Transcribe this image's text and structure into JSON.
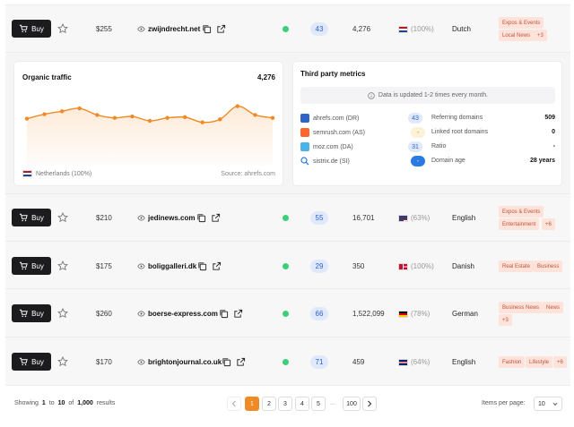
{
  "rows": [
    {
      "buy": "Buy",
      "price": "$255",
      "domain": "zwijndrecht.net",
      "dr": "43",
      "traffic": "4,276",
      "country_pct": "(100%)",
      "flag": "nl",
      "language": "Dutch",
      "tags": [
        "Expos & Events",
        "Local News",
        "+3"
      ]
    },
    {
      "buy": "Buy",
      "price": "$210",
      "domain": "jedinews.com",
      "dr": "55",
      "traffic": "16,701",
      "country_pct": "(63%)",
      "flag": "us",
      "language": "English",
      "tags": [
        "Expos & Events",
        "Entertainment",
        "+6"
      ]
    },
    {
      "buy": "Buy",
      "price": "$175",
      "domain": "boliggalleri.dk",
      "dr": "29",
      "traffic": "350",
      "country_pct": "(100%)",
      "flag": "dk",
      "language": "Danish",
      "tags": [
        "Real Estate",
        "Business"
      ]
    },
    {
      "buy": "Buy",
      "price": "$260",
      "domain": "boerse-express.com",
      "dr": "66",
      "traffic": "1,522,099",
      "country_pct": "(78%)",
      "flag": "de",
      "language": "German",
      "tags": [
        "Business News",
        "News",
        "+3"
      ]
    },
    {
      "buy": "Buy",
      "price": "$170",
      "domain": "brightonjournal.co.uk",
      "dr": "71",
      "traffic": "459",
      "country_pct": "(64%)",
      "flag": "gb",
      "language": "English",
      "tags": [
        "Fashion",
        "Lifestyle",
        "+6"
      ]
    }
  ],
  "organic": {
    "title": "Organic traffic",
    "value": "4,276",
    "country": "Netherlands (100%)",
    "source": "Source: ahrefs.com"
  },
  "chart_data": {
    "type": "area",
    "values": [
      3.2,
      3.5,
      3.7,
      3.9,
      3.45,
      3.25,
      3.35,
      3.05,
      3.25,
      3.3,
      2.95,
      3.15,
      4.05,
      3.45,
      3.25
    ],
    "ylim": [
      0,
      5
    ],
    "color": "#f08a24",
    "grid": false
  },
  "third_party": {
    "title": "Third party metrics",
    "info": "Data is updated 1-2 times every month.",
    "metrics": [
      {
        "name": "ahrefs.com (DR)",
        "value": "43",
        "color": "#2e64c8",
        "badge_bg": "#dfe9fb",
        "badge_fg": "#2e64c8",
        "icon": "ahrefs-logo"
      },
      {
        "name": "semrush.com (AS)",
        "value": "-",
        "color": "#ff642d",
        "badge_bg": "#fdf1d6",
        "badge_fg": "#b27a12",
        "icon": "semrush-logo"
      },
      {
        "name": "moz.com (DA)",
        "value": "31",
        "color": "#4cb3e6",
        "badge_bg": "#dfe9fb",
        "badge_fg": "#2e64c8",
        "icon": "moz-logo"
      },
      {
        "name": "sistrix.de (SI)",
        "value": "-",
        "color": "#2a7ae2",
        "badge_bg": "#2a7ae2",
        "badge_fg": "#ffffff",
        "icon": "search-icon"
      }
    ],
    "stats": [
      {
        "label": "Referring domains",
        "value": "509"
      },
      {
        "label": "Linked root domains",
        "value": "0"
      },
      {
        "label": "Ratio",
        "value": "-"
      },
      {
        "label": "Domain age",
        "value": "28 years"
      }
    ]
  },
  "pagination": {
    "showing_prefix": "Showing",
    "from": "1",
    "to_word": "to",
    "to": "10",
    "of_word": "of",
    "total": "1,000",
    "results_word": "results",
    "pages": [
      "1",
      "2",
      "3",
      "4",
      "5"
    ],
    "ellipsis": "...",
    "last_page": "100",
    "per_page_label": "Items per page:",
    "per_page_value": "10"
  },
  "colors": {
    "accent": "#f08a24",
    "dark_button": "#1c1c1e",
    "status_green": "#3ccf7a"
  }
}
